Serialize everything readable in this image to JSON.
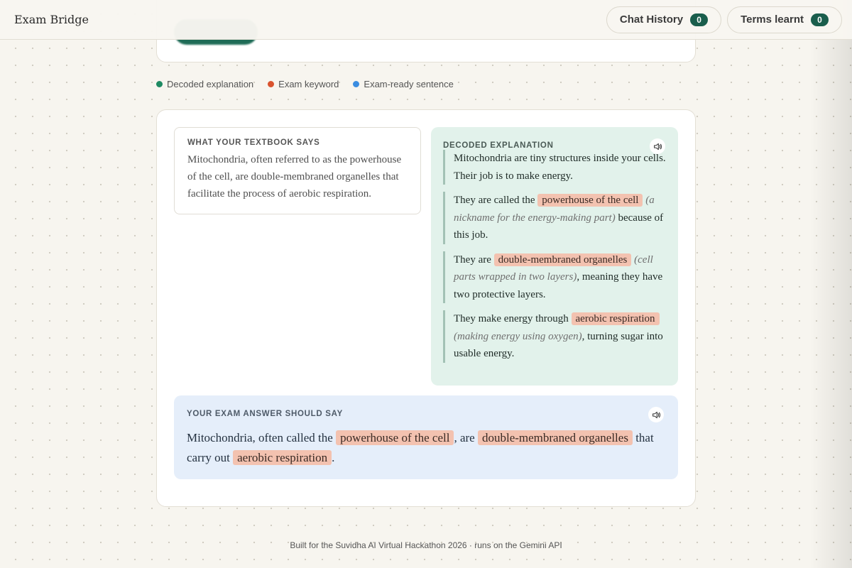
{
  "app": {
    "title": "Exam Bridge"
  },
  "nav": {
    "chat_history": {
      "label": "Chat History",
      "count": "0"
    },
    "terms_learnt": {
      "label": "Terms learnt",
      "count": "0"
    }
  },
  "legend": [
    {
      "label": "Decoded explanation",
      "color": "#1e8a62"
    },
    {
      "label": "Exam keyword",
      "color": "#d9532e"
    },
    {
      "label": "Exam-ready sentence",
      "color": "#3b8de0"
    }
  ],
  "textbook": {
    "heading": "WHAT YOUR TEXTBOOK SAYS",
    "text": "Mitochondria, often referred to as the powerhouse of the cell, are double-membraned organelles that facilitate the process of aerobic respiration."
  },
  "decoded": {
    "heading": "DECODED EXPLANATION",
    "speaker_icon": "speaker-icon",
    "points": [
      {
        "text": "Mitochondria are tiny structures inside your cells. Their job is to make energy."
      },
      {
        "pre": "They are called the",
        "term": "powerhouse of the cell",
        "gloss": "(a nickname for the energy-making part)",
        "post": "because of this job."
      },
      {
        "pre": "They are",
        "term": "double-membraned organelles",
        "gloss": "(cell parts wrapped in two layers)",
        "post": ", meaning they have two protective layers."
      },
      {
        "pre": "They make energy through",
        "term": "aerobic respiration",
        "gloss": "(making energy using oxygen)",
        "post": ", turning sugar into usable energy."
      }
    ]
  },
  "exam": {
    "heading": "YOUR EXAM ANSWER SHOULD SAY",
    "speaker_icon": "speaker-icon",
    "parts": {
      "p1": "Mitochondria, often called the",
      "t1": "powerhouse of the cell",
      "p2": ", are",
      "t2": "double-membraned organelles",
      "p3": "that carry out",
      "t3": "aerobic respiration",
      "p4": "."
    }
  },
  "colors": {
    "accent": "#1a5e4c",
    "keyword_highlight": "#f3c2b0",
    "decoded_bg": "#e2f2eb",
    "exam_bg": "#e5eefa"
  },
  "footer": {
    "text": "Built for the Suvidha AI Virtual Hackathon 2026 · runs on the Gemini API"
  }
}
